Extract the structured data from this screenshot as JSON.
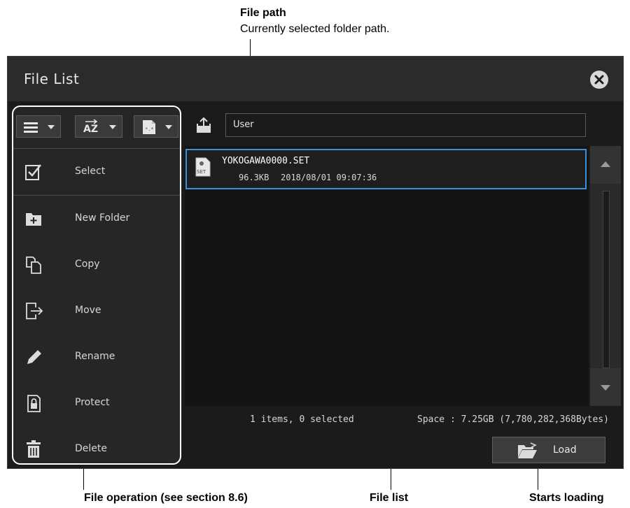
{
  "callouts": {
    "file_path_title": "File path",
    "file_path_desc": "Currently selected folder path.",
    "file_operation": "File operation (see section 8.6)",
    "file_list": "File list",
    "starts_loading": "Starts loading"
  },
  "dialog": {
    "title": "File List"
  },
  "toolbar": {
    "view_icon": "list-view-icon",
    "sort_icon": "sort-az-icon",
    "filter_icon": "file-filter-icon",
    "sort_label": "AZ"
  },
  "operations": [
    {
      "label": "Select",
      "icon": "checkbox-icon"
    },
    {
      "label": "New Folder",
      "icon": "new-folder-icon"
    },
    {
      "label": "Copy",
      "icon": "copy-icon"
    },
    {
      "label": "Move",
      "icon": "move-icon"
    },
    {
      "label": "Rename",
      "icon": "pencil-icon"
    },
    {
      "label": "Protect",
      "icon": "lock-file-icon"
    },
    {
      "label": "Delete",
      "icon": "trash-icon"
    }
  ],
  "path": {
    "value": "User"
  },
  "files": [
    {
      "name": "YOKOGAWA0000.SET",
      "size": "96.3KB",
      "date": "2018/08/01 09:07:36",
      "badge": "SET"
    }
  ],
  "status": {
    "count": "1 items, 0 selected",
    "space": "Space : 7.25GB (7,780,282,368Bytes)"
  },
  "load_button": {
    "label": "Load"
  },
  "colors": {
    "accent": "#3a8fd9",
    "background": "#1b1b1b"
  }
}
